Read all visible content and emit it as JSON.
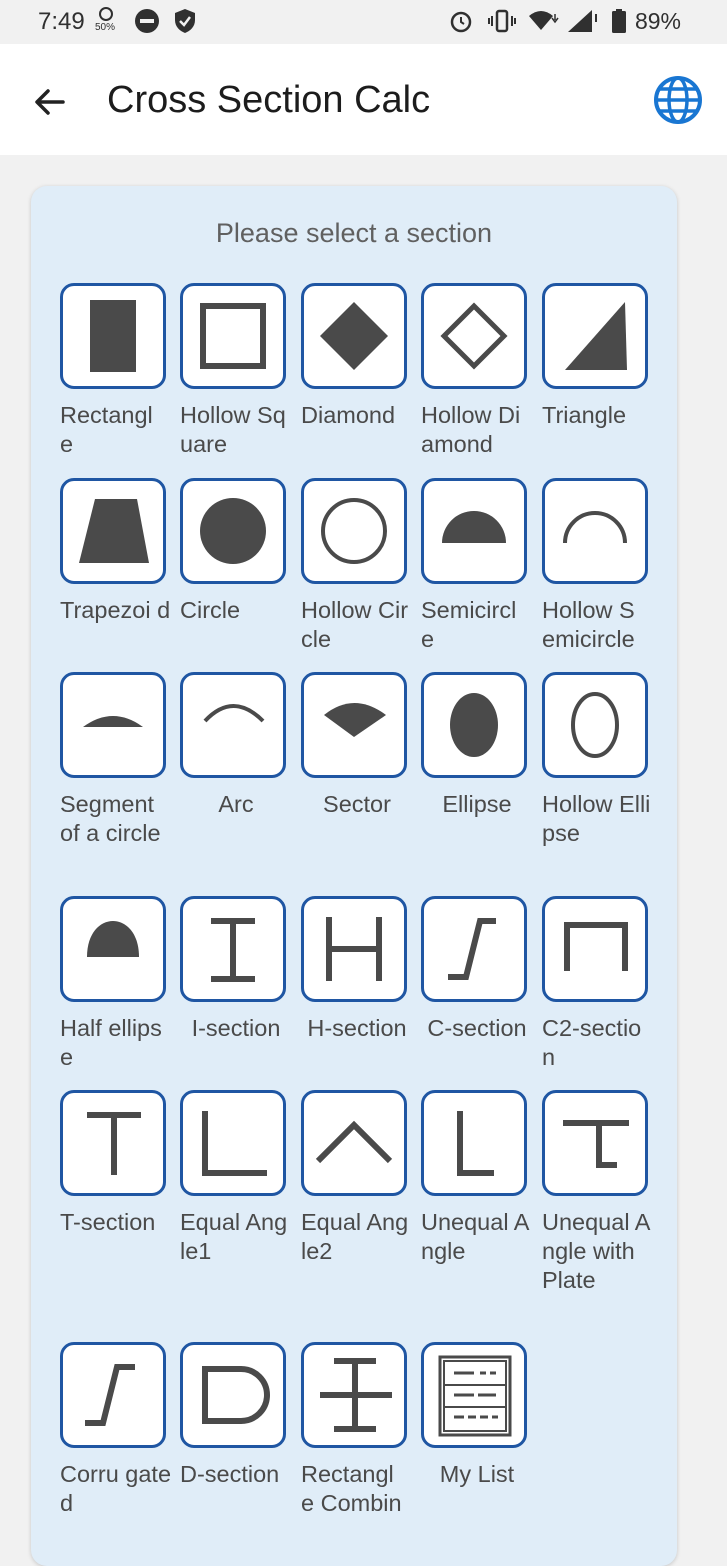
{
  "status_bar": {
    "time": "7:49",
    "battery_percent": "89%",
    "notification_sub": "50%"
  },
  "app_bar": {
    "title": "Cross Section Calc"
  },
  "card": {
    "title": "Please select a section"
  },
  "sections": [
    {
      "label": "Rectangl e",
      "icon": "rectangle-icon"
    },
    {
      "label": "Hollow Square",
      "icon": "hollow-square-icon"
    },
    {
      "label": "Diamond",
      "icon": "diamond-icon"
    },
    {
      "label": "Hollow Diamond",
      "icon": "hollow-diamond-icon"
    },
    {
      "label": "Triangle",
      "icon": "triangle-icon"
    },
    {
      "label": "Trapezoi d",
      "icon": "trapezoid-icon"
    },
    {
      "label": "Circle",
      "icon": "circle-icon"
    },
    {
      "label": "Hollow Circle",
      "icon": "hollow-circle-icon"
    },
    {
      "label": "Semicircl e",
      "icon": "semicircle-icon"
    },
    {
      "label": "Hollow S emicircle",
      "icon": "hollow-semicircle-icon"
    },
    {
      "label": "Segment of a circle",
      "icon": "segment-icon"
    },
    {
      "label": "Arc",
      "icon": "arc-icon"
    },
    {
      "label": "Sector",
      "icon": "sector-icon"
    },
    {
      "label": "Ellipse",
      "icon": "ellipse-icon"
    },
    {
      "label": "Hollow Ellipse",
      "icon": "hollow-ellipse-icon"
    },
    {
      "label": "Half ellipse",
      "icon": "half-ellipse-icon"
    },
    {
      "label": "I-section",
      "icon": "i-section-icon"
    },
    {
      "label": "H-section",
      "icon": "h-section-icon"
    },
    {
      "label": "C-section",
      "icon": "c-section-icon"
    },
    {
      "label": "C2-sectio n",
      "icon": "c2-section-icon"
    },
    {
      "label": "T-section",
      "icon": "t-section-icon"
    },
    {
      "label": "Equal Angle1",
      "icon": "equal-angle1-icon"
    },
    {
      "label": "Equal Angle2",
      "icon": "equal-angle2-icon"
    },
    {
      "label": "Unequal Angle",
      "icon": "unequal-angle-icon"
    },
    {
      "label": "Unequal Angle with Plate",
      "icon": "unequal-angle-plate-icon"
    },
    {
      "label": "Corru gated",
      "icon": "corrugated-icon"
    },
    {
      "label": "D-section",
      "icon": "d-section-icon"
    },
    {
      "label": "Rectangl e Combin",
      "icon": "rectangle-combination-icon"
    },
    {
      "label": "My List",
      "icon": "my-list-icon"
    }
  ],
  "colors": {
    "accent": "#1f56a3",
    "card_bg": "#e0edf8",
    "icon_fill": "#4a4a4a",
    "globe": "#1976d2"
  }
}
